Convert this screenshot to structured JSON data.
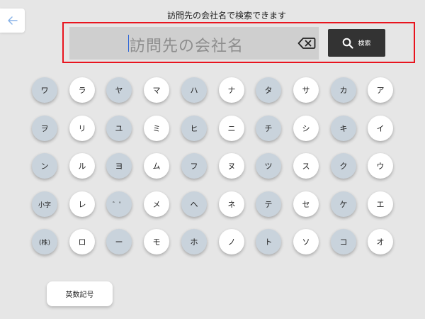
{
  "caption": "訪問先の会社名で検索できます",
  "search": {
    "placeholder": "訪問先の会社名",
    "button_label": "検索",
    "clear_icon": "backspace-icon",
    "search_icon": "search-icon"
  },
  "back_icon": "arrow-left-icon",
  "keyboard": {
    "rows": [
      [
        "ワ",
        "ラ",
        "ヤ",
        "マ",
        "ハ",
        "ナ",
        "タ",
        "サ",
        "カ",
        "ア"
      ],
      [
        "ヲ",
        "リ",
        "ユ",
        "ミ",
        "ヒ",
        "ニ",
        "チ",
        "シ",
        "キ",
        "イ"
      ],
      [
        "ン",
        "ル",
        "ヨ",
        "ム",
        "フ",
        "ヌ",
        "ツ",
        "ス",
        "ク",
        "ウ"
      ],
      [
        "小字",
        "レ",
        "゛゜",
        "メ",
        "ヘ",
        "ネ",
        "テ",
        "セ",
        "ケ",
        "エ"
      ],
      [
        "(株)",
        "ロ",
        "ー",
        "モ",
        "ホ",
        "ノ",
        "ト",
        "ソ",
        "コ",
        "オ"
      ]
    ]
  },
  "alnum_button_label": "英数記号",
  "colors": {
    "highlight_border": "#e8141e",
    "search_button": "#333333",
    "key_gray": "#c9d3dc",
    "key_white": "#ffffff",
    "caret": "#2a64d8",
    "back_arrow": "#8ab4e8"
  }
}
